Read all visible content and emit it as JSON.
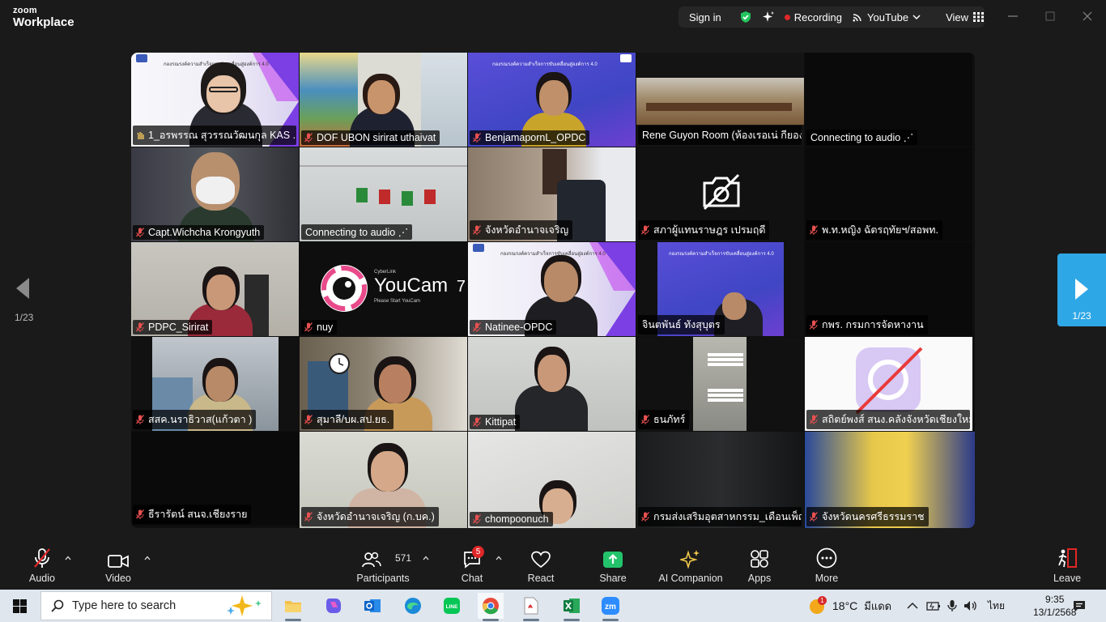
{
  "titlebar": {
    "logo_top": "zoom",
    "logo_bottom": "Workplace",
    "signin": "Sign in",
    "recording": "Recording",
    "livestream": "YouTube",
    "view": "View",
    "colors": {
      "shield": "#22c55e",
      "recording_dot": "#e02828"
    }
  },
  "stage": {
    "tiles": [
      {
        "name": "1_อรพรรณ สุวรรณวัฒนกุล KAS ...",
        "active": true,
        "icon": "hand"
      },
      {
        "name": "DOF UBON sirirat uthaivat",
        "muted": true
      },
      {
        "name": "BenjamapornL_OPDC",
        "muted": true
      },
      {
        "name": "Rene Guyon Room (ห้องเรอเน่ กียอง)",
        "muted": false
      },
      {
        "name": "Connecting to audio ⋰",
        "muted": false
      },
      {
        "name": "Capt.Wichcha Krongyuth",
        "muted": true
      },
      {
        "name": "Connecting to audio ⋰",
        "muted": false
      },
      {
        "name": "จังหวัดอำนาจเจริญ",
        "muted": true
      },
      {
        "name": "สภาผู้แทนราษฎร เปรมฤดี",
        "muted": true,
        "camera_off": true
      },
      {
        "name": "พ.ท.หญิง ฉัตรฤทัยฯ/สอพท.",
        "muted": true
      },
      {
        "name": "PDPC_Sirirat",
        "muted": true
      },
      {
        "name": "nuy",
        "muted": true,
        "youcam": {
          "title": "YouCam",
          "num": "7",
          "brand": "CyberLink",
          "sub": "Please Start YouCam"
        }
      },
      {
        "name": "Natinee-OPDC",
        "muted": true
      },
      {
        "name": "จินตพันธ์ ทังสุบุตร",
        "muted": false
      },
      {
        "name": "กพร. กรมการจัดหางาน",
        "muted": true
      },
      {
        "name": "สสค.นราธิวาส(แก้วตา )",
        "muted": true
      },
      {
        "name": "สุมาลี/บผ.สป.ยธ.",
        "muted": true
      },
      {
        "name": "Kittipat",
        "muted": true
      },
      {
        "name": "ธนภัทร์",
        "muted": true
      },
      {
        "name": "สถิตย์พงส์ สนง.คลังจังหวัดเชียงใหม่",
        "muted": true
      },
      {
        "name": "ธีรารัตน์ สนจ.เชียงราย",
        "muted": true
      },
      {
        "name": "จังหวัดอำนาจเจริญ (ก.บค.)",
        "muted": true
      },
      {
        "name": "chompoonuch",
        "muted": true
      },
      {
        "name": "กรมส่งเสริมอุตสาหกรรม_เดือนเพ็ญ",
        "muted": true
      },
      {
        "name": "จังหวัดนครศรีธรรมราช",
        "muted": true
      }
    ],
    "banner_text": "กองรณรงค์ความสำเร็จการขับเคลื่อนสู่องค์การ 4.0",
    "page_left": "1/23",
    "page_right": "1/23"
  },
  "toolbar": {
    "audio": "Audio",
    "video": "Video",
    "participants": "Participants",
    "participants_count": "571",
    "chat": "Chat",
    "chat_badge": "5",
    "react": "React",
    "share": "Share",
    "ai": "AI Companion",
    "apps": "Apps",
    "more": "More",
    "leave": "Leave",
    "colors": {
      "share": "#23c36b",
      "ai": "#f2c94c",
      "leave": "#e02828"
    }
  },
  "taskbar": {
    "search_placeholder": "Type here to search",
    "weather": "18°C",
    "weather_desc": "มีแดด",
    "lang": "ไทย",
    "time": "9:35",
    "date": "13/1/2568",
    "weather_badge": "1"
  }
}
